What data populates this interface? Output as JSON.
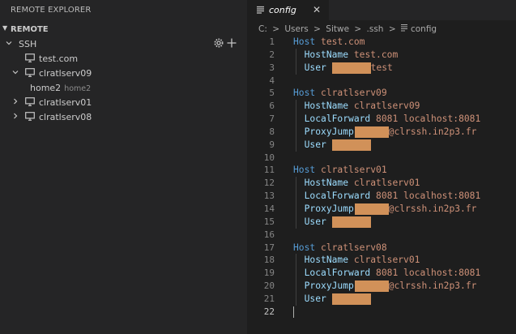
{
  "sidebar": {
    "title": "REMOTE EXPLORER",
    "section": "REMOTE",
    "group": "SSH",
    "hosts": [
      {
        "name": "test.com"
      },
      {
        "name": "clratlserv09",
        "child": {
          "name": "home2",
          "desc": "home2"
        }
      },
      {
        "name": "clratlserv01"
      },
      {
        "name": "clratlserv08"
      }
    ]
  },
  "editor": {
    "tab": {
      "label": "config",
      "close": "✕"
    },
    "breadcrumb": [
      "C:",
      "Users",
      "Sitwe",
      ".ssh",
      "config"
    ],
    "breadcrumb_sep": ">",
    "lines": [
      {
        "n": "1",
        "kw": "Host",
        "val": "test.com"
      },
      {
        "n": "2",
        "prop": "HostName",
        "val": "test.com"
      },
      {
        "n": "3",
        "prop": "User",
        "val": "test"
      },
      {
        "n": "4"
      },
      {
        "n": "5",
        "kw": "Host",
        "val": "clratlserv09"
      },
      {
        "n": "6",
        "prop": "HostName",
        "val": "clratlserv09"
      },
      {
        "n": "7",
        "prop": "LocalForward",
        "val": "8081 localhost:8081"
      },
      {
        "n": "8",
        "prop": "ProxyJump",
        "val": "@clrssh.in2p3.fr"
      },
      {
        "n": "9",
        "prop": "User"
      },
      {
        "n": "10"
      },
      {
        "n": "11",
        "kw": "Host",
        "val": "clratlserv01"
      },
      {
        "n": "12",
        "prop": "HostName",
        "val": "clratlserv01"
      },
      {
        "n": "13",
        "prop": "LocalForward",
        "val": "8081 localhost:8081"
      },
      {
        "n": "14",
        "prop": "ProxyJump",
        "val": "@clrssh.in2p3.fr"
      },
      {
        "n": "15",
        "prop": "User"
      },
      {
        "n": "16"
      },
      {
        "n": "17",
        "kw": "Host",
        "val": "clratlserv08"
      },
      {
        "n": "18",
        "prop": "HostName",
        "val": "clratlserv01"
      },
      {
        "n": "19",
        "prop": "LocalForward",
        "val": "8081 localhost:8081"
      },
      {
        "n": "20",
        "prop": "ProxyJump",
        "val": "@clrssh.in2p3.fr"
      },
      {
        "n": "21",
        "prop": "User"
      },
      {
        "n": "22"
      }
    ]
  },
  "colors": {
    "redaction": "#d19159",
    "keyword": "#569cd6",
    "property": "#9cdcfe",
    "string": "#ce9178"
  }
}
